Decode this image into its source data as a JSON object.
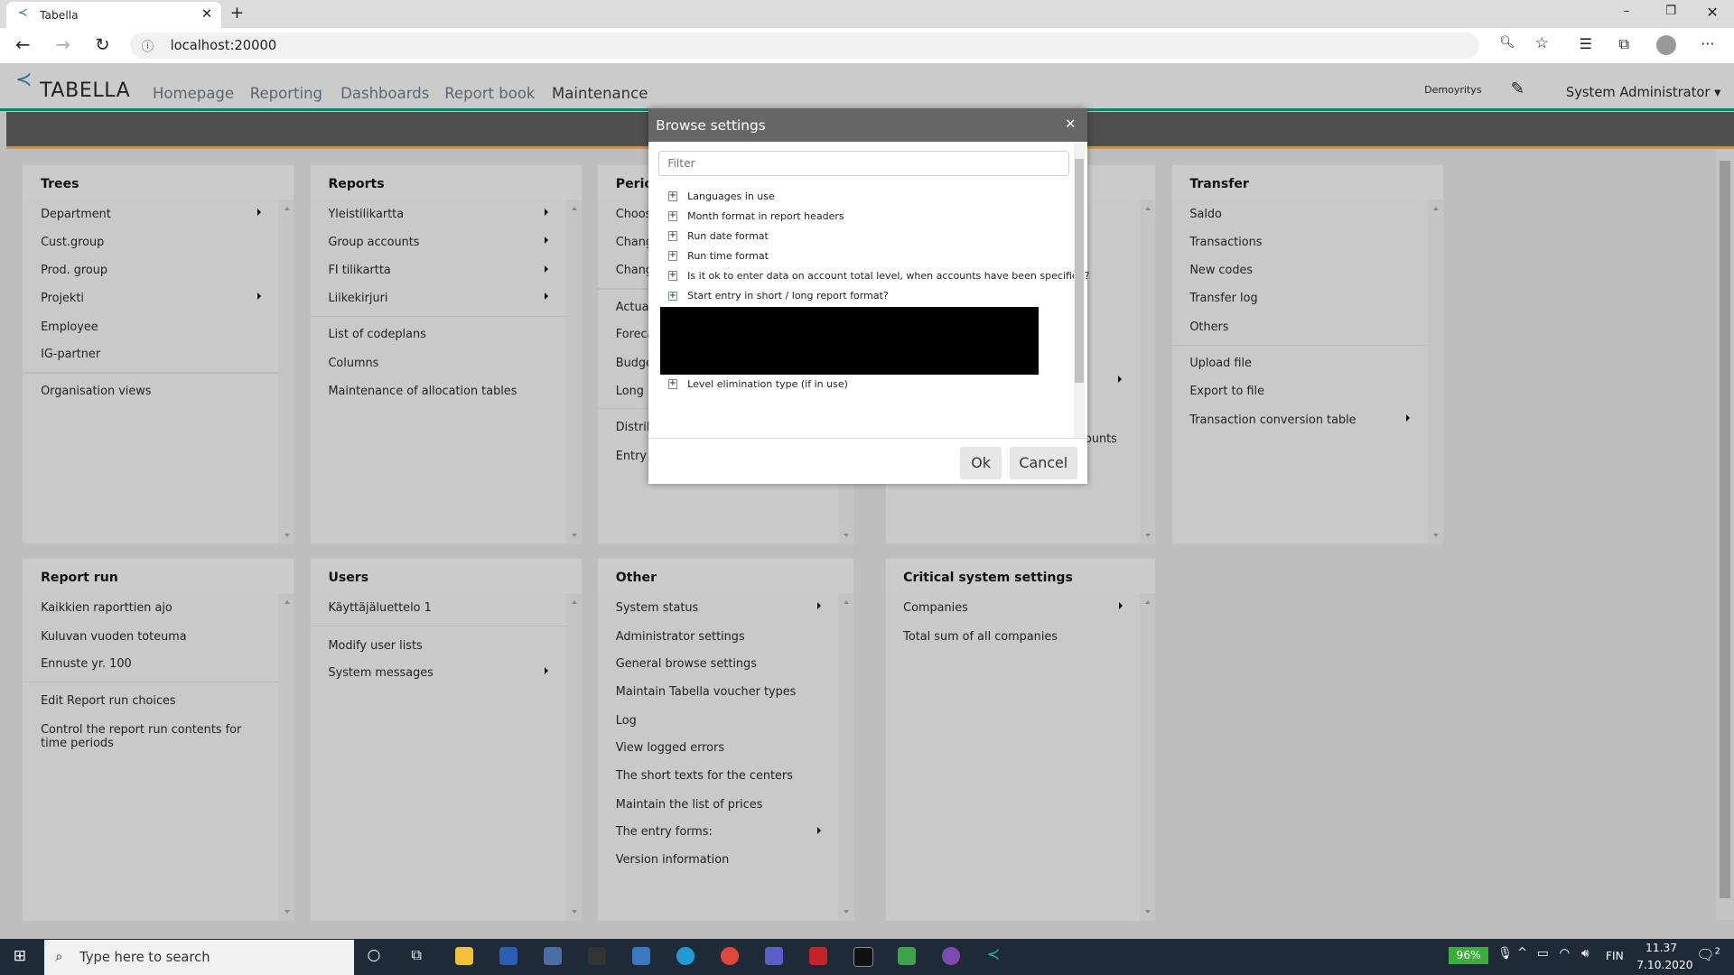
{
  "browser": {
    "tab_title": "Tabella",
    "url": "localhost:20000"
  },
  "app": {
    "logo": "TABELLA",
    "nav": [
      "Homepage",
      "Reporting",
      "Dashboards",
      "Report book",
      "Maintenance"
    ],
    "company": "Demoyritys",
    "user": "System Administrator"
  },
  "panels": [
    {
      "title": "Trees",
      "items": [
        "Department",
        "Cust.group",
        "Prod. group",
        "Projekti",
        "Employee",
        "IG-partner",
        "Organisation views"
      ]
    },
    {
      "title": "Reports",
      "items": [
        "Yleistilikartta",
        "Group accounts",
        "FI tilikartta",
        "Liikekirjuri",
        "List of codeplans",
        "Columns",
        "Maintenance of allocation tables"
      ]
    },
    {
      "title": "Perio",
      "items": [
        "Choos",
        "Chang",
        "Chang",
        "Actual",
        "Foreca",
        "Budge",
        "Long r",
        "Distrib",
        "Entry"
      ]
    },
    {
      "title": "",
      "items": [
        "ounts"
      ]
    },
    {
      "title": "Transfer",
      "items": [
        "Saldo",
        "Transactions",
        "New codes",
        "Transfer log",
        "Others",
        "Upload file",
        "Export to file",
        "Transaction conversion table"
      ]
    },
    {
      "title": "Report run",
      "items": [
        "Kaikkien raporttien ajo",
        "Kuluvan vuoden toteuma",
        "Ennuste yr. 100",
        "Edit Report run choices",
        "Control the report run contents for time periods"
      ]
    },
    {
      "title": "Users",
      "items": [
        "Käyttäjäluettelo 1",
        "Modify user lists",
        "System messages"
      ]
    },
    {
      "title": "Other",
      "items": [
        "System status",
        "Administrator settings",
        "General browse settings",
        "Maintain Tabella voucher types",
        "Log",
        "View logged errors",
        "The short texts for the centers",
        "Maintain the list of prices",
        "The entry forms:",
        "Version information"
      ]
    },
    {
      "title": "Critical system settings",
      "items": [
        "Companies",
        "Total sum of all companies"
      ]
    }
  ],
  "modal": {
    "title": "Browse settings",
    "filter_placeholder": "Filter",
    "options": [
      "Languages in use",
      "Month format in report headers",
      "Run date format",
      "Run time format",
      "Is it ok to enter data on account total level, when accounts have been specified?",
      "Start entry in short / long report format?",
      "Level elimination type (if in use)"
    ],
    "ok": "Ok",
    "cancel": "Cancel"
  },
  "taskbar": {
    "search_placeholder": "Type here to search",
    "battery": "96%",
    "lang": "FIN",
    "time": "11.37",
    "date": "7.10.2020",
    "notifications": "2"
  },
  "colors": {
    "accent_teal": "#17806f",
    "accent_orange": "#c49455"
  }
}
